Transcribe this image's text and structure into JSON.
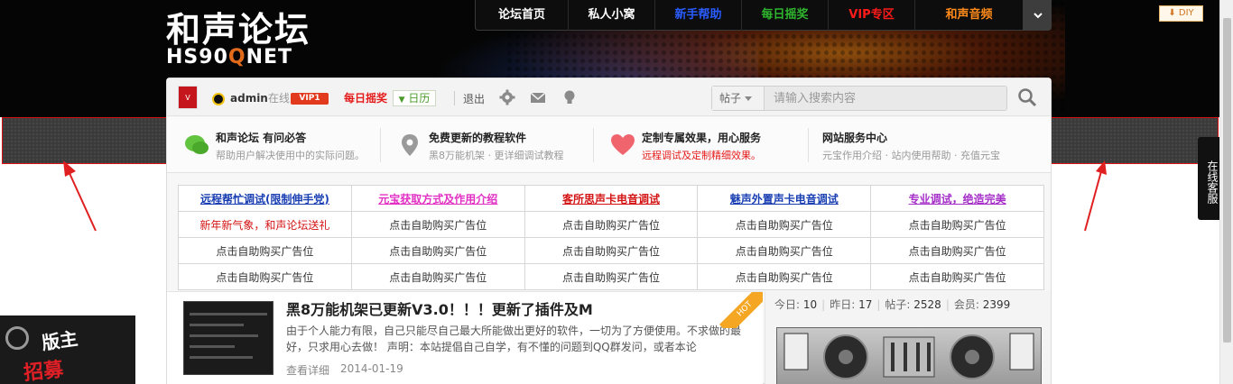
{
  "logo": {
    "cn": "和声论坛",
    "en_prefix": "HS90",
    "en_q": "Q",
    "en_suffix": "NET"
  },
  "topnav": {
    "items": [
      {
        "label": "论坛首页",
        "color": "#ffffff"
      },
      {
        "label": "私人小窝",
        "color": "#ffffff"
      },
      {
        "label": "新手帮助",
        "color": "#2a5cff"
      },
      {
        "label": "每日摇奖",
        "color": "#2fb52f"
      },
      {
        "label": "VIP专区",
        "color": "#ff1a1a"
      },
      {
        "label": "和声音频",
        "color": "#ff8a1a"
      }
    ],
    "toggle_icon": "chevron-down-icon"
  },
  "diy": {
    "label": "DIY"
  },
  "userbar": {
    "username": "admin",
    "status": "在线",
    "vip": "VIP1",
    "daily": "每日摇奖",
    "calendar": "日历",
    "logout": "退出",
    "icons": [
      "gear-icon",
      "mail-icon",
      "lightbulb-icon"
    ]
  },
  "search": {
    "type_label": "帖子",
    "placeholder": "请输入搜索内容"
  },
  "features": [
    {
      "title": "和声论坛 有问必答",
      "desc": "帮助用户解决使用中的实际问题。",
      "icon": "chat-icon",
      "color": "#62c33e"
    },
    {
      "title": "免费更新的教程软件",
      "desc": "黑8万能机架 · 更详细调试教程",
      "icon": "location-pin-icon",
      "color": "#9a9a9a"
    },
    {
      "title": "定制专属效果，用心服务",
      "desc": "远程调试及定制精细效果。",
      "icon": "heart-icon",
      "color": "#f0646e"
    },
    {
      "title": "网站服务中心",
      "desc": "元宝作用介绍 · 站内使用帮助 · 充值元宝",
      "icon": "none",
      "color": "#999999"
    }
  ],
  "adtable": {
    "header": [
      {
        "label": "远程帮忙调试(限制伸手党)",
        "color": "#1a3fb3"
      },
      {
        "label": "元宝获取方式及作用介绍",
        "color": "#e22fc4"
      },
      {
        "label": "客所思声卡电音调试",
        "color": "#d41414"
      },
      {
        "label": "魅声外置声卡电音调试",
        "color": "#1a3fb3"
      },
      {
        "label": "专业调试，绝造完美",
        "color": "#a52fc8"
      }
    ],
    "rows": [
      [
        {
          "label": "新年新气象，和声论坛送礼",
          "color": "#d41414"
        },
        {
          "label": "点击自助购买广告位",
          "color": "#333333"
        },
        {
          "label": "点击自助购买广告位",
          "color": "#333333"
        },
        {
          "label": "点击自助购买广告位",
          "color": "#333333"
        },
        {
          "label": "点击自助购买广告位",
          "color": "#333333"
        }
      ],
      [
        {
          "label": "点击自助购买广告位",
          "color": "#333333"
        },
        {
          "label": "点击自助购买广告位",
          "color": "#333333"
        },
        {
          "label": "点击自助购买广告位",
          "color": "#333333"
        },
        {
          "label": "点击自助购买广告位",
          "color": "#333333"
        },
        {
          "label": "点击自助购买广告位",
          "color": "#333333"
        }
      ],
      [
        {
          "label": "点击自助购买广告位",
          "color": "#333333"
        },
        {
          "label": "点击自助购买广告位",
          "color": "#333333"
        },
        {
          "label": "点击自助购买广告位",
          "color": "#333333"
        },
        {
          "label": "点击自助购买广告位",
          "color": "#333333"
        },
        {
          "label": "点击自助购买广告位",
          "color": "#333333"
        }
      ]
    ]
  },
  "article": {
    "title": "黑8万能机架已更新V3.0！！！更新了插件及M",
    "desc": "由于个人能力有限，自己只能尽自己最大所能做出更好的软件，一切为了方便使用。不求做的最好，只求用心去做！ 声明：本站提倡自己自学，有不懂的问题到QQ群发问，或者本论",
    "more": "查看详细",
    "date": "2014-01-19",
    "badge": "HOT"
  },
  "stats": {
    "today_label": "今日:",
    "today": "10",
    "yesterday_label": "昨日:",
    "yesterday": "17",
    "posts_label": "帖子:",
    "posts": "2528",
    "members_label": "会员:",
    "members": "2399"
  },
  "service": {
    "label": "在线客服"
  },
  "recruit": {
    "line1": "版主",
    "line2": "招募"
  }
}
